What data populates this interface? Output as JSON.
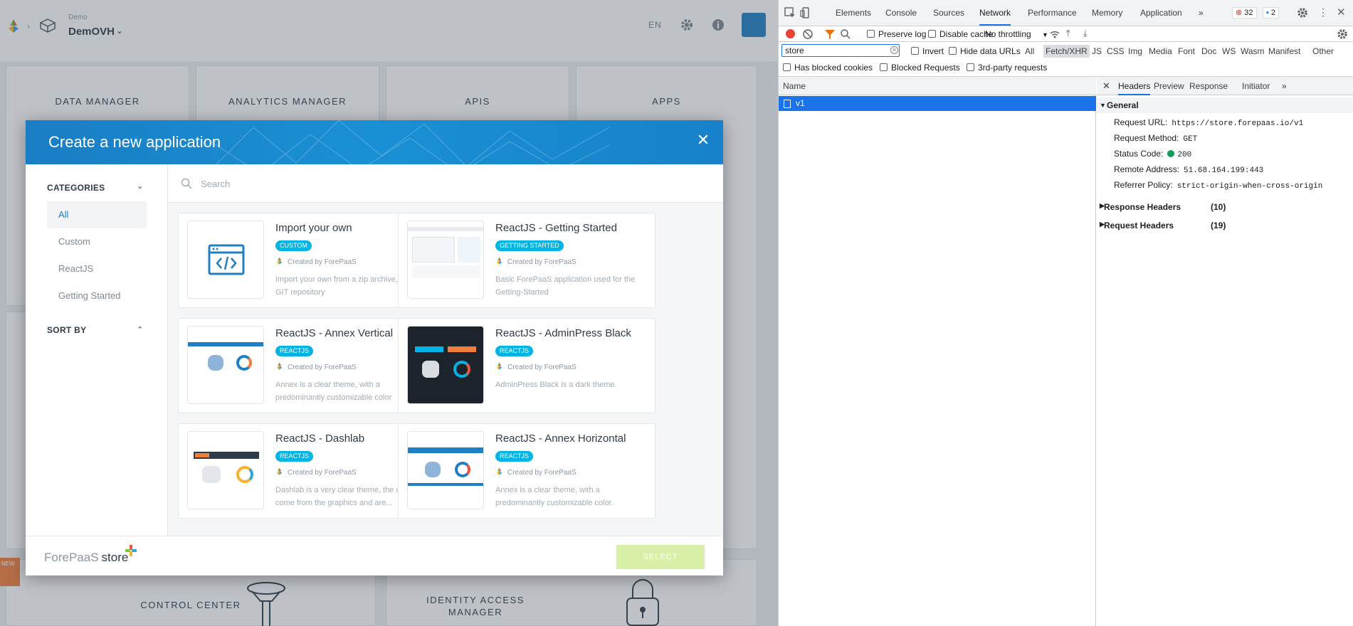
{
  "app": {
    "project_sub": "Demo",
    "project_name": "DemOVH",
    "language": "EN",
    "tiles": [
      "DATA MANAGER",
      "ANALYTICS MANAGER",
      "APIS",
      "APPS",
      "CONTROL CENTER",
      "IDENTITY ACCESS MANAGER"
    ],
    "new_ribbon": "NEW"
  },
  "modal": {
    "title": "Create a new application",
    "categories_label": "CATEGORIES",
    "categories": [
      "All",
      "Custom",
      "ReactJS",
      "Getting Started"
    ],
    "sort_label": "SORT BY",
    "search_placeholder": "Search",
    "cards": [
      {
        "title": "Import your own",
        "badge": "CUSTOM",
        "creator": "Created by ForePaaS",
        "desc": "Import your own from a zip archive, or a GIT repository"
      },
      {
        "title": "ReactJS - Getting Started",
        "badge": "GETTING STARTED",
        "creator": "Created by ForePaaS",
        "desc": "Basic ForePaaS application used for the Getting-Started"
      },
      {
        "title": "ReactJS - Annex Vertical",
        "badge": "REACTJS",
        "creator": "Created by ForePaaS",
        "desc": "Annex is a clear theme, with a predominantly customizable color"
      },
      {
        "title": "ReactJS - AdminPress Black",
        "badge": "REACTJS",
        "creator": "Created by ForePaaS",
        "desc": "AdminPress Black is a dark theme."
      },
      {
        "title": "ReactJS - Dashlab",
        "badge": "REACTJS",
        "creator": "Created by ForePaaS",
        "desc": "Dashlab is a very clear theme, the colors come from the graphics and are..."
      },
      {
        "title": "ReactJS - Annex Horizontal",
        "badge": "REACTJS",
        "creator": "Created by ForePaaS",
        "desc": "Annex is a clear theme, with a predominantly customizable color."
      }
    ],
    "brand_name": "ForePaaS",
    "brand_store": "store",
    "select_label": "SELECT"
  },
  "devtools": {
    "tabs": [
      "Elements",
      "Console",
      "Sources",
      "Network",
      "Performance",
      "Memory",
      "Application"
    ],
    "active_tab": "Network",
    "error_count": "32",
    "message_count": "2",
    "preserve_log": "Preserve log",
    "disable_cache": "Disable cache",
    "throttling": "No throttling",
    "filter_value": "store",
    "invert": "Invert",
    "hide_data_urls": "Hide data URLs",
    "filter_types": [
      "All",
      "Fetch/XHR",
      "JS",
      "CSS",
      "Img",
      "Media",
      "Font",
      "Doc",
      "WS",
      "Wasm",
      "Manifest",
      "Other"
    ],
    "active_filter_type": "Fetch/XHR",
    "has_blocked_cookies": "Has blocked cookies",
    "blocked_requests": "Blocked Requests",
    "third_party": "3rd-party requests",
    "name_col": "Name",
    "request_name": "v1",
    "detail_tabs": [
      "Headers",
      "Preview",
      "Response",
      "Initiator"
    ],
    "general_label": "General",
    "general": [
      {
        "key": "Request URL:",
        "value": "https://store.forepaas.io/v1"
      },
      {
        "key": "Request Method:",
        "value": "GET"
      },
      {
        "key": "Status Code:",
        "value": "200"
      },
      {
        "key": "Remote Address:",
        "value": "51.68.164.199:443"
      },
      {
        "key": "Referrer Policy:",
        "value": "strict-origin-when-cross-origin"
      }
    ],
    "response_headers_label": "Response Headers",
    "response_headers_count": "(10)",
    "request_headers_label": "Request Headers",
    "request_headers_count": "(19)"
  }
}
